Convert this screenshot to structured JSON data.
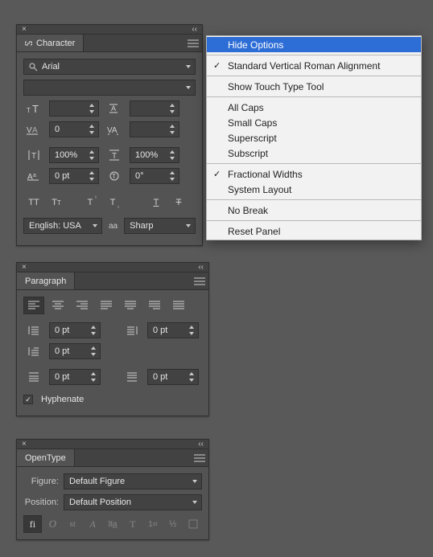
{
  "character": {
    "tab_label": "Character",
    "font": "Arial",
    "style": "",
    "size": "",
    "leading": "",
    "kerning": "0",
    "tracking": "",
    "vscale": "100%",
    "hscale": "100%",
    "baseline": "0 pt",
    "rotation": "0°",
    "language": "English: USA",
    "aa_label": "aa",
    "aa": "Sharp"
  },
  "paragraph": {
    "tab_label": "Paragraph",
    "indent_left": "0 pt",
    "indent_right": "0 pt",
    "first_line": "0 pt",
    "space_before": "0 pt",
    "space_after": "0 pt",
    "hyphenate_label": "Hyphenate",
    "hyphenate_checked": true
  },
  "opentype": {
    "tab_label": "OpenType",
    "figure_label": "Figure:",
    "figure": "Default Figure",
    "position_label": "Position:",
    "position": "Default Position"
  },
  "menu": {
    "items": [
      {
        "label": "Hide Options",
        "hi": true,
        "chk": false
      },
      {
        "sep": true
      },
      {
        "label": "Standard Vertical Roman Alignment",
        "hi": false,
        "chk": true
      },
      {
        "sep": true
      },
      {
        "label": "Show Touch Type Tool",
        "hi": false,
        "chk": false
      },
      {
        "sep": true
      },
      {
        "label": "All Caps",
        "hi": false,
        "chk": false
      },
      {
        "label": "Small Caps",
        "hi": false,
        "chk": false
      },
      {
        "label": "Superscript",
        "hi": false,
        "chk": false
      },
      {
        "label": "Subscript",
        "hi": false,
        "chk": false
      },
      {
        "sep": true
      },
      {
        "label": "Fractional Widths",
        "hi": false,
        "chk": true
      },
      {
        "label": "System Layout",
        "hi": false,
        "chk": false
      },
      {
        "sep": true
      },
      {
        "label": "No Break",
        "hi": false,
        "chk": false
      },
      {
        "sep": true
      },
      {
        "label": "Reset Panel",
        "hi": false,
        "chk": false
      }
    ]
  }
}
